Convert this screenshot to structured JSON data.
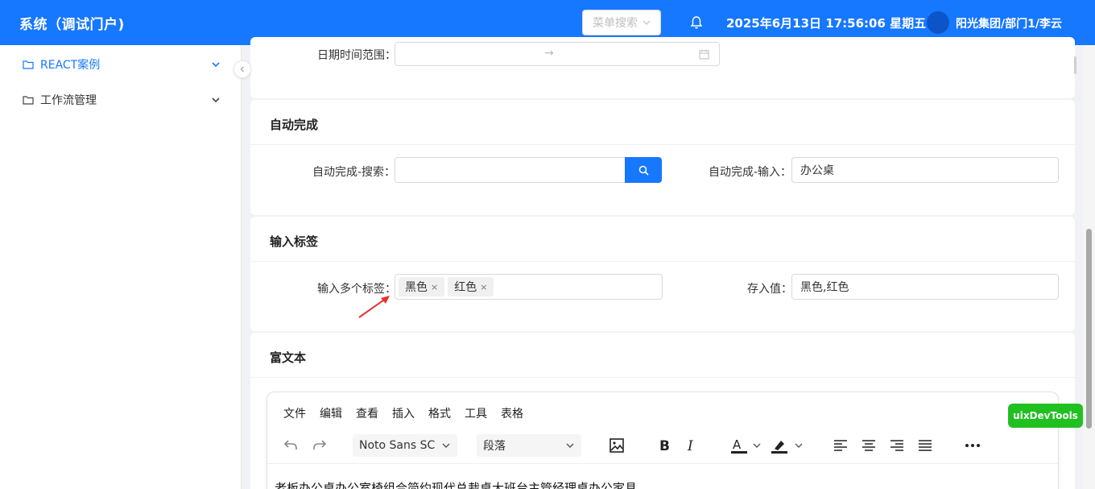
{
  "header": {
    "title": "系统（调试门户)",
    "menu_search_placeholder": "菜单搜索",
    "datetime": "2025年6月13日 17:56:06 星期五",
    "user": "阳光集团/部门1/李云",
    "color": "#1677ff"
  },
  "sidebar": {
    "items": [
      {
        "label": "REACT案例",
        "icon": "folder-icon",
        "active": true
      },
      {
        "label": "工作流管理",
        "icon": "folder-icon",
        "active": false
      }
    ]
  },
  "date_section": {
    "label": "日期时间范围：",
    "separator": "→"
  },
  "autocomplete_section": {
    "title": "自动完成",
    "search_label": "自动完成-搜索：",
    "search_value": "",
    "input_label": "自动完成-输入：",
    "input_value": "办公桌"
  },
  "tags_section": {
    "title": "输入标签",
    "tags_label": "输入多个标签：",
    "tags": [
      "黑色",
      "红色"
    ],
    "tag_remove": "×",
    "stored_label": "存入值：",
    "stored_value": "黑色,红色"
  },
  "richtext_section": {
    "title": "富文本",
    "menu": [
      "文件",
      "编辑",
      "查看",
      "插入",
      "格式",
      "工具",
      "表格"
    ],
    "font_family": "Noto Sans SC",
    "block_format": "段落",
    "content": "老板办公桌办公室椅组合简约现代总裁桌大班台主管经理桌办公家具"
  },
  "devtools": {
    "label": "uixDevTools",
    "color": "#21c021"
  }
}
